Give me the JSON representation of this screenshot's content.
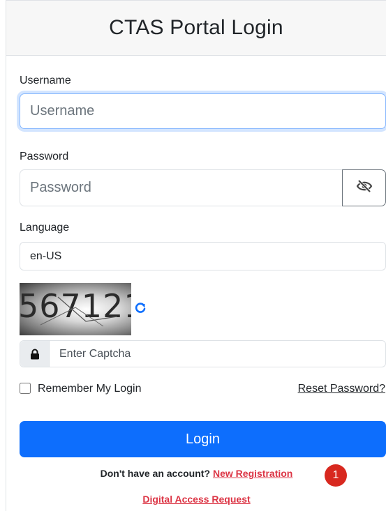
{
  "header": {
    "title": "CTAS Portal Login"
  },
  "form": {
    "username": {
      "label": "Username",
      "placeholder": "Username"
    },
    "password": {
      "label": "Password",
      "placeholder": "Password",
      "toggle_icon": "eye-slash-icon"
    },
    "language": {
      "label": "Language",
      "selected": "en-US"
    },
    "captcha": {
      "image_text": "567121",
      "refresh_icon": "refresh-icon",
      "lock_icon": "lock-icon",
      "placeholder": "Enter Captcha"
    },
    "remember_label": "Remember My Login",
    "reset_password_label": "Reset Password?",
    "login_label": "Login"
  },
  "footer": {
    "no_account_text": "Don't have an account?",
    "new_registration_label": "New Registration",
    "digital_access_label": "Digital Access Request",
    "annotation_badge": "1"
  },
  "colors": {
    "primary": "#0d6efd",
    "link_red": "#dc3545",
    "badge_red": "#d8281f",
    "header_bg": "#f7f7f7"
  }
}
